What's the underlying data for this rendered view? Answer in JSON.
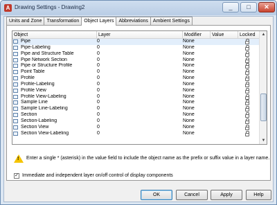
{
  "window": {
    "title": "Drawing Settings - Drawing2",
    "app_icon": "autocad-logo"
  },
  "tabs": [
    {
      "label": "Units and Zone",
      "active": false
    },
    {
      "label": "Transformation",
      "active": false
    },
    {
      "label": "Object Layers",
      "active": true
    },
    {
      "label": "Abbreviations",
      "active": false
    },
    {
      "label": "Ambient Settings",
      "active": false
    }
  ],
  "table": {
    "headers": {
      "object": "Object",
      "layer": "Layer",
      "modifier": "Modifier",
      "value": "Value",
      "locked": "Locked"
    },
    "rows": [
      {
        "object": "Pipe",
        "layer": "0",
        "modifier": "None",
        "selected": true
      },
      {
        "object": "Pipe-Labeling",
        "layer": "0",
        "modifier": "None"
      },
      {
        "object": "Pipe and Structure Table",
        "layer": "0",
        "modifier": "None"
      },
      {
        "object": "Pipe Network Section",
        "layer": "0",
        "modifier": "None"
      },
      {
        "object": "Pipe or Structure Profile",
        "layer": "0",
        "modifier": "None"
      },
      {
        "object": "Point Table",
        "layer": "0",
        "modifier": "None"
      },
      {
        "object": "Profile",
        "layer": "0",
        "modifier": "None"
      },
      {
        "object": "Profile-Labeling",
        "layer": "0",
        "modifier": "None"
      },
      {
        "object": "Profile View",
        "layer": "0",
        "modifier": "None"
      },
      {
        "object": "Profile View-Labeling",
        "layer": "0",
        "modifier": "None"
      },
      {
        "object": "Sample Line",
        "layer": "0",
        "modifier": "None"
      },
      {
        "object": "Sample Line-Labeling",
        "layer": "0",
        "modifier": "None"
      },
      {
        "object": "Section",
        "layer": "0",
        "modifier": "None"
      },
      {
        "object": "Section-Labeling",
        "layer": "0",
        "modifier": "None"
      },
      {
        "object": "Section View",
        "layer": "0",
        "modifier": "None"
      },
      {
        "object": "Section View-Labeling",
        "layer": "0",
        "modifier": "None"
      }
    ]
  },
  "hint": {
    "text": "Enter a single * (asterisk) in the value field to include the object name as the prefix or suffix value in a layer name.",
    "icon": "warning-icon"
  },
  "checkbox": {
    "label": "Immediate and independent layer on/off control of display components",
    "checked": true
  },
  "buttons": {
    "ok": "OK",
    "cancel": "Cancel",
    "apply": "Apply",
    "help": "Help"
  }
}
